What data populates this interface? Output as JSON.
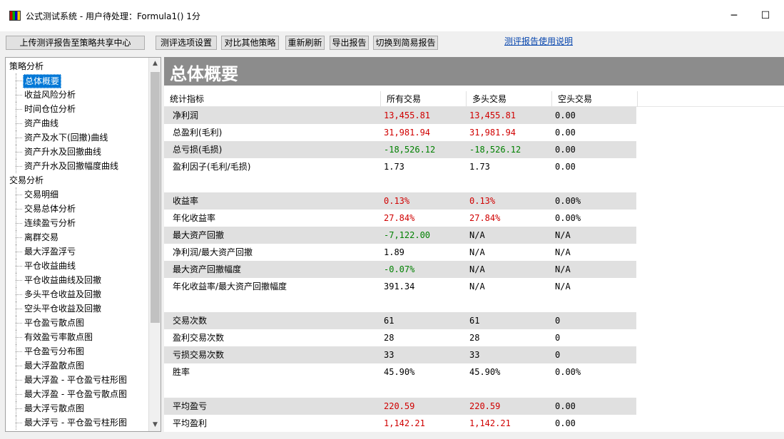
{
  "window": {
    "title": "公式测试系统 - 用户待处理：Formula1() 1分",
    "minimize_glyph": "─",
    "maximize_glyph": "☐"
  },
  "toolbar": {
    "upload": "上传测评报告至策略共享中心",
    "options": "测评选项设置",
    "compare": "对比其他策略",
    "refresh": "重新刷新",
    "export": "导出报告",
    "switch": "切换到简易报告",
    "help_link": "测评报告使用说明"
  },
  "tree": {
    "group1": "策略分析",
    "group1_items": [
      "总体概要",
      "收益风险分析",
      "时间仓位分析",
      "资产曲线",
      "资产及水下(回撤)曲线",
      "资产升水及回撤曲线",
      "资产升水及回撤幅度曲线"
    ],
    "group2": "交易分析",
    "group2_items": [
      "交易明细",
      "交易总体分析",
      "连续盈亏分析",
      "离群交易",
      "最大浮盈浮亏",
      "平仓收益曲线",
      "平仓收益曲线及回撤",
      "多头平仓收益及回撤",
      "空头平仓收益及回撤",
      "平仓盈亏散点图",
      "有效盈亏率散点图",
      "平仓盈亏分布图",
      "最大浮盈散点图",
      "最大浮盈 - 平仓盈亏柱形图",
      "最大浮盈 - 平仓盈亏散点图",
      "最大浮亏散点图",
      "最大浮亏 - 平仓盈亏柱形图"
    ],
    "selected": "总体概要"
  },
  "main": {
    "header": "总体概要",
    "columns": [
      "统计指标",
      "所有交易",
      "多头交易",
      "空头交易"
    ],
    "rows": [
      {
        "label": "净利润",
        "all": "13,455.81",
        "long": "13,455.81",
        "short": "0.00",
        "style": "red"
      },
      {
        "label": "总盈利(毛利)",
        "all": "31,981.94",
        "long": "31,981.94",
        "short": "0.00",
        "style": "red"
      },
      {
        "label": "总亏损(毛损)",
        "all": "-18,526.12",
        "long": "-18,526.12",
        "short": "0.00",
        "style": "green"
      },
      {
        "label": "盈利因子(毛利/毛损)",
        "all": "1.73",
        "long": "1.73",
        "short": "0.00",
        "style": ""
      },
      {
        "label": "",
        "all": "",
        "long": "",
        "short": "",
        "style": ""
      },
      {
        "label": "收益率",
        "all": "0.13%",
        "long": "0.13%",
        "short": "0.00%",
        "style": "red"
      },
      {
        "label": "年化收益率",
        "all": "27.84%",
        "long": "27.84%",
        "short": "0.00%",
        "style": "red"
      },
      {
        "label": "最大资产回撤",
        "all": "-7,122.00",
        "long": "N/A",
        "short": "N/A",
        "style": "green1"
      },
      {
        "label": "净利润/最大资产回撤",
        "all": "1.89",
        "long": "N/A",
        "short": "N/A",
        "style": ""
      },
      {
        "label": "最大资产回撤幅度",
        "all": "-0.07%",
        "long": "N/A",
        "short": "N/A",
        "style": "green1"
      },
      {
        "label": "年化收益率/最大资产回撤幅度",
        "all": "391.34",
        "long": "N/A",
        "short": "N/A",
        "style": ""
      },
      {
        "label": "",
        "all": "",
        "long": "",
        "short": "",
        "style": ""
      },
      {
        "label": "交易次数",
        "all": "61",
        "long": "61",
        "short": "0",
        "style": ""
      },
      {
        "label": "盈利交易次数",
        "all": "28",
        "long": "28",
        "short": "0",
        "style": ""
      },
      {
        "label": "亏损交易次数",
        "all": "33",
        "long": "33",
        "short": "0",
        "style": ""
      },
      {
        "label": "胜率",
        "all": "45.90%",
        "long": "45.90%",
        "short": "0.00%",
        "style": ""
      },
      {
        "label": "",
        "all": "",
        "long": "",
        "short": "",
        "style": ""
      },
      {
        "label": "平均盈亏",
        "all": "220.59",
        "long": "220.59",
        "short": "0.00",
        "style": "red"
      },
      {
        "label": "平均盈利",
        "all": "1,142.21",
        "long": "1,142.21",
        "short": "0.00",
        "style": "red"
      }
    ]
  }
}
